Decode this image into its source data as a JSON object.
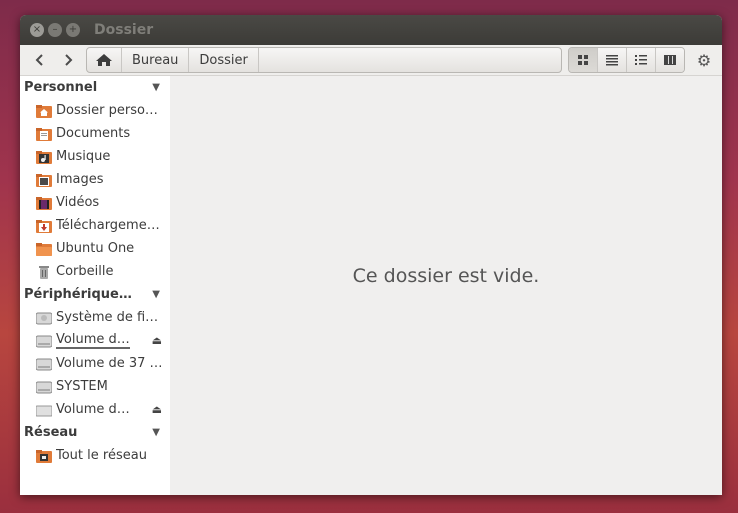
{
  "window": {
    "title": "Dossier",
    "controls": {
      "close": "×",
      "minimize": "–",
      "maximize": "+"
    }
  },
  "toolbar": {
    "back_icon": "‹",
    "forward_icon": "›",
    "breadcrumbs": [
      "Bureau",
      "Dossier"
    ],
    "views": [
      "icon-view",
      "list-view",
      "compact-view",
      "columns-view"
    ],
    "active_view": "icon-view",
    "settings_icon": "⚙"
  },
  "sidebar": {
    "sections": [
      {
        "label": "Personnel",
        "items": [
          {
            "label": "Dossier perso…",
            "icon": "home-folder-icon"
          },
          {
            "label": "Documents",
            "icon": "documents-folder-icon"
          },
          {
            "label": "Musique",
            "icon": "music-folder-icon"
          },
          {
            "label": "Images",
            "icon": "pictures-folder-icon"
          },
          {
            "label": "Vidéos",
            "icon": "videos-folder-icon"
          },
          {
            "label": "Téléchargeme…",
            "icon": "downloads-folder-icon"
          },
          {
            "label": "Ubuntu One",
            "icon": "folder-icon"
          },
          {
            "label": "Corbeille",
            "icon": "trash-icon"
          }
        ]
      },
      {
        "label": "Périphérique…",
        "items": [
          {
            "label": "Système de fi…",
            "icon": "drive-icon"
          },
          {
            "label": "Volume d…",
            "icon": "drive-icon",
            "eject": true
          },
          {
            "label": "Volume de 37 …",
            "icon": "drive-icon"
          },
          {
            "label": "SYSTEM",
            "icon": "drive-icon"
          },
          {
            "label": "Volume d…",
            "icon": "removable-drive-icon",
            "eject": true
          }
        ]
      },
      {
        "label": "Réseau",
        "items": [
          {
            "label": "Tout le réseau",
            "icon": "network-icon"
          }
        ]
      }
    ],
    "eject_glyph": "⏏",
    "caret_glyph": "▼"
  },
  "main": {
    "empty_message": "Ce dossier est vide."
  },
  "colors": {
    "titlebar": "#3c3b37",
    "sidebar": "#ffffff",
    "content": "#f0efee",
    "folder_orange": "#e07b39"
  }
}
